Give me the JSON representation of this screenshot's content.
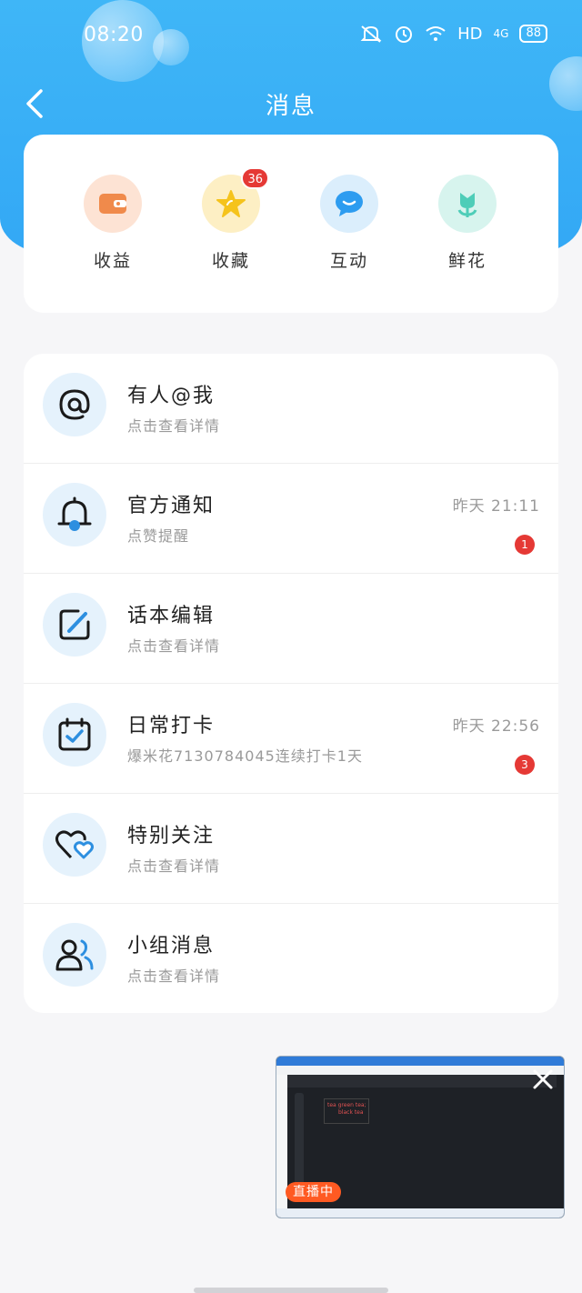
{
  "status_bar": {
    "time": "08:20",
    "network": "HD",
    "signal": "4G",
    "battery": "88"
  },
  "nav": {
    "title": "消息"
  },
  "quick_actions": [
    {
      "label": "收益",
      "icon": "wallet-icon",
      "bg": "#fde3d4",
      "color": "#f08a4b"
    },
    {
      "label": "收藏",
      "icon": "star-icon",
      "bg": "#fdefc4",
      "color": "#f5c31c",
      "badge": "36"
    },
    {
      "label": "互动",
      "icon": "chat-bubble-icon",
      "bg": "#dbeefc",
      "color": "#2d9cf0"
    },
    {
      "label": "鲜花",
      "icon": "flower-icon",
      "bg": "#d7f4ee",
      "color": "#4ecdb8"
    }
  ],
  "messages": [
    {
      "title": "有人@我",
      "subtitle": "点击查看详情",
      "time": "",
      "badge": "",
      "icon": "at-sign-icon"
    },
    {
      "title": "官方通知",
      "subtitle": "点赞提醒",
      "time": "昨天 21:11",
      "badge": "1",
      "icon": "bell-icon"
    },
    {
      "title": "话本编辑",
      "subtitle": "点击查看详情",
      "time": "",
      "badge": "",
      "icon": "edit-icon"
    },
    {
      "title": "日常打卡",
      "subtitle": "爆米花7130784045连续打卡1天",
      "time": "昨天 22:56",
      "badge": "3",
      "icon": "calendar-check-icon"
    },
    {
      "title": "特别关注",
      "subtitle": "点击查看详情",
      "time": "",
      "badge": "",
      "icon": "hearts-icon"
    },
    {
      "title": "小组消息",
      "subtitle": "点击查看详情",
      "time": "",
      "badge": "",
      "icon": "group-icon"
    }
  ],
  "pip": {
    "live_label": "直播中",
    "editor_line1": "tea green tea;",
    "editor_line2": "black tea"
  },
  "colors": {
    "header": "#3fb6f7",
    "badge": "#e53935",
    "live": "#ff5a22"
  }
}
